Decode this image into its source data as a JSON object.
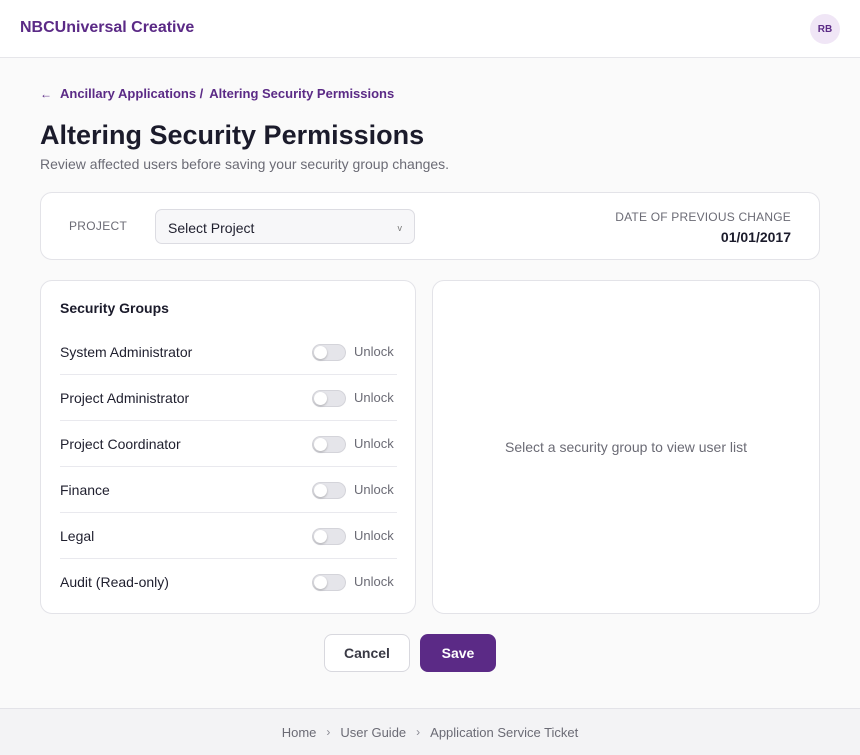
{
  "header": {
    "brand": "NBCUniversal Creative",
    "avatar_initials": "RB"
  },
  "breadcrumb": {
    "back_icon": "arrow-left-icon",
    "parent": "Ancillary Applications /",
    "current": "Altering Security Permissions"
  },
  "page": {
    "title": "Altering Security Permissions",
    "subtitle": "Review affected users before saving your security group changes."
  },
  "project": {
    "label": "PROJECT",
    "select_value": "Select Project",
    "chevron": "v",
    "date_label": "DATE OF PREVIOUS CHANGE",
    "date_value": "01/01/2017"
  },
  "security_groups": {
    "title": "Security Groups",
    "toggle_label": "Unlock",
    "items": [
      {
        "name": "System Administrator",
        "unlocked": false
      },
      {
        "name": "Project Administrator",
        "unlocked": false
      },
      {
        "name": "Project Coordinator",
        "unlocked": false
      },
      {
        "name": "Finance",
        "unlocked": false
      },
      {
        "name": "Legal",
        "unlocked": false
      },
      {
        "name": "Audit (Read-only)",
        "unlocked": false
      }
    ]
  },
  "user_panel": {
    "empty_message": "Select a security group to view user list"
  },
  "actions": {
    "cancel_label": "Cancel",
    "save_label": "Save"
  },
  "footer": {
    "links": [
      "Home",
      "User Guide",
      "Application Service Ticket"
    ],
    "separator": "›"
  },
  "colors": {
    "brand": "#5b2a86",
    "background": "#fafafa",
    "card": "#ffffff"
  }
}
